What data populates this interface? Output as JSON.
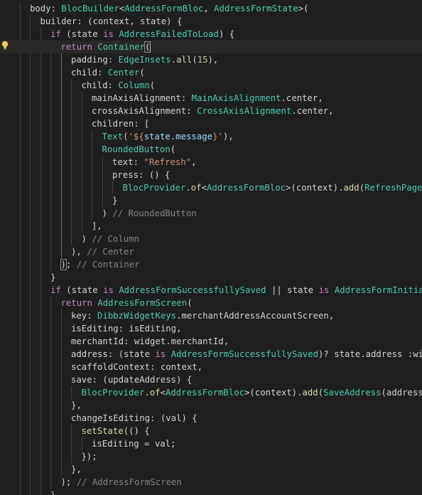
{
  "editor": {
    "lines": [
      {
        "indent": 2,
        "tokens": [
          [
            "plain",
            "body: "
          ],
          [
            "type",
            "BlocBuilder"
          ],
          [
            "plain",
            "<"
          ],
          [
            "type",
            "AddressFormBloc"
          ],
          [
            "plain",
            ", "
          ],
          [
            "type",
            "AddressFormState"
          ],
          [
            "plain",
            ">("
          ]
        ]
      },
      {
        "indent": 3,
        "tokens": [
          [
            "plain",
            "builder: (context, state) {"
          ]
        ]
      },
      {
        "indent": 4,
        "tokens": [
          [
            "kw",
            "if"
          ],
          [
            "plain",
            " (state "
          ],
          [
            "kw",
            "is"
          ],
          [
            "plain",
            " "
          ],
          [
            "type",
            "AddressFailedToLoad"
          ],
          [
            "plain",
            ") {"
          ]
        ]
      },
      {
        "indent": 5,
        "active": true,
        "tokens": [
          [
            "kw",
            "return"
          ],
          [
            "plain",
            " "
          ],
          [
            "type",
            "Container"
          ],
          [
            "bracket",
            "("
          ]
        ]
      },
      {
        "indent": 6,
        "tokens": [
          [
            "plain",
            "padding: "
          ],
          [
            "type",
            "EdgeInsets"
          ],
          [
            "plain",
            "."
          ],
          [
            "fn",
            "all"
          ],
          [
            "plain",
            "("
          ],
          [
            "num",
            "15"
          ],
          [
            "plain",
            "),"
          ]
        ]
      },
      {
        "indent": 6,
        "tokens": [
          [
            "plain",
            "child: "
          ],
          [
            "type",
            "Center"
          ],
          [
            "plain",
            "("
          ]
        ]
      },
      {
        "indent": 7,
        "tokens": [
          [
            "plain",
            "child: "
          ],
          [
            "type",
            "Column"
          ],
          [
            "plain",
            "("
          ]
        ]
      },
      {
        "indent": 8,
        "tokens": [
          [
            "plain",
            "mainAxisAlignment: "
          ],
          [
            "type",
            "MainAxisAlignment"
          ],
          [
            "plain",
            ".center,"
          ]
        ]
      },
      {
        "indent": 8,
        "tokens": [
          [
            "plain",
            "crossAxisAlignment: "
          ],
          [
            "type",
            "CrossAxisAlignment"
          ],
          [
            "plain",
            ".center,"
          ]
        ]
      },
      {
        "indent": 8,
        "tokens": [
          [
            "plain",
            "children: ["
          ]
        ]
      },
      {
        "indent": 9,
        "tokens": [
          [
            "type",
            "Text"
          ],
          [
            "plain",
            "("
          ],
          [
            "str",
            "'${"
          ],
          [
            "prop",
            "state.message"
          ],
          [
            "str",
            "}'"
          ],
          [
            "plain",
            "),"
          ]
        ]
      },
      {
        "indent": 9,
        "tokens": [
          [
            "type",
            "RoundedButton"
          ],
          [
            "plain",
            "("
          ]
        ]
      },
      {
        "indent": 10,
        "tokens": [
          [
            "plain",
            "text: "
          ],
          [
            "str",
            "\"Refresh\""
          ],
          [
            "plain",
            ","
          ]
        ]
      },
      {
        "indent": 10,
        "tokens": [
          [
            "plain",
            "press: () {"
          ]
        ]
      },
      {
        "indent": 11,
        "tokens": [
          [
            "type",
            "BlocProvider"
          ],
          [
            "plain",
            "."
          ],
          [
            "fn",
            "of"
          ],
          [
            "plain",
            "<"
          ],
          [
            "type",
            "AddressFormBloc"
          ],
          [
            "plain",
            ">(context)."
          ],
          [
            "fn",
            "add"
          ],
          [
            "plain",
            "("
          ],
          [
            "type",
            "RefreshPage"
          ],
          [
            "plain",
            "(a"
          ]
        ]
      },
      {
        "indent": 10,
        "tokens": [
          [
            "plain",
            "}"
          ]
        ]
      },
      {
        "indent": 9,
        "tokens": [
          [
            "plain",
            ") "
          ],
          [
            "cmt",
            "// RoundedButton"
          ]
        ]
      },
      {
        "indent": 8,
        "tokens": [
          [
            "plain",
            "],"
          ]
        ]
      },
      {
        "indent": 7,
        "tokens": [
          [
            "plain",
            ") "
          ],
          [
            "cmt",
            "// Column"
          ]
        ]
      },
      {
        "indent": 6,
        "tokens": [
          [
            "plain",
            "), "
          ],
          [
            "cmt",
            "// Center"
          ]
        ]
      },
      {
        "indent": 5,
        "tokens": [
          [
            "bracket",
            ")"
          ],
          [
            "plain",
            "; "
          ],
          [
            "cmt",
            "// Container"
          ]
        ]
      },
      {
        "indent": 4,
        "tokens": [
          [
            "plain",
            "}"
          ]
        ]
      },
      {
        "indent": 4,
        "tokens": [
          [
            "kw",
            "if"
          ],
          [
            "plain",
            " (state "
          ],
          [
            "kw",
            "is"
          ],
          [
            "plain",
            " "
          ],
          [
            "type",
            "AddressFormSuccessfullySaved"
          ],
          [
            "plain",
            " || state "
          ],
          [
            "kw",
            "is"
          ],
          [
            "plain",
            " "
          ],
          [
            "type",
            "AddressFormInitial"
          ],
          [
            "plain",
            ")"
          ]
        ]
      },
      {
        "indent": 5,
        "tokens": [
          [
            "kw",
            "return"
          ],
          [
            "plain",
            " "
          ],
          [
            "type",
            "AddressFormScreen"
          ],
          [
            "plain",
            "("
          ]
        ]
      },
      {
        "indent": 6,
        "tokens": [
          [
            "plain",
            "key: "
          ],
          [
            "type",
            "DibbzWidgetKeys"
          ],
          [
            "plain",
            ".merchantAddressAccountScreen,"
          ]
        ]
      },
      {
        "indent": 6,
        "tokens": [
          [
            "plain",
            "isEditing: isEditing,"
          ]
        ]
      },
      {
        "indent": 6,
        "tokens": [
          [
            "plain",
            "merchantId: widget.merchantId,"
          ]
        ]
      },
      {
        "indent": 6,
        "tokens": [
          [
            "plain",
            "address: (state "
          ],
          [
            "kw",
            "is"
          ],
          [
            "plain",
            " "
          ],
          [
            "type",
            "AddressFormSuccessfullySaved"
          ],
          [
            "plain",
            ")? state.address :widg"
          ]
        ]
      },
      {
        "indent": 6,
        "tokens": [
          [
            "plain",
            "scaffoldContext: context,"
          ]
        ]
      },
      {
        "indent": 6,
        "tokens": [
          [
            "plain",
            "save: (updateAddress) {"
          ]
        ]
      },
      {
        "indent": 7,
        "tokens": [
          [
            "type",
            "BlocProvider"
          ],
          [
            "plain",
            "."
          ],
          [
            "fn",
            "of"
          ],
          [
            "plain",
            "<"
          ],
          [
            "type",
            "AddressFormBloc"
          ],
          [
            "plain",
            ">(context)."
          ],
          [
            "fn",
            "add"
          ],
          [
            "plain",
            "("
          ],
          [
            "type",
            "SaveAddress"
          ],
          [
            "plain",
            "(address:"
          ]
        ]
      },
      {
        "indent": 6,
        "tokens": [
          [
            "plain",
            "},"
          ]
        ]
      },
      {
        "indent": 6,
        "tokens": [
          [
            "plain",
            "changeIsEditing: (val) {"
          ]
        ]
      },
      {
        "indent": 7,
        "tokens": [
          [
            "fn",
            "setState"
          ],
          [
            "plain",
            "(() {"
          ]
        ]
      },
      {
        "indent": 8,
        "tokens": [
          [
            "plain",
            "isEditing = val;"
          ]
        ]
      },
      {
        "indent": 7,
        "tokens": [
          [
            "plain",
            "});"
          ]
        ]
      },
      {
        "indent": 6,
        "tokens": [
          [
            "plain",
            "},"
          ]
        ]
      },
      {
        "indent": 5,
        "tokens": [
          [
            "plain",
            "); "
          ],
          [
            "cmt",
            "// AddressFormScreen"
          ]
        ]
      },
      {
        "indent": 4,
        "tokens": [
          [
            "plain",
            "}"
          ]
        ]
      }
    ]
  },
  "gutter": {
    "lightbulb_line": 4
  },
  "colors": {
    "background": "#1e1e1e",
    "plain": "#d4d4d4",
    "keyword": "#c586c0",
    "type": "#4ec9b0",
    "function": "#dcdcaa",
    "property": "#9cdcfe",
    "number": "#b5cea8",
    "string": "#ce9178",
    "comment": "#858585",
    "lightbulb": "#f2c94c"
  },
  "icons": {
    "lightbulb": "lightbulb-icon"
  }
}
